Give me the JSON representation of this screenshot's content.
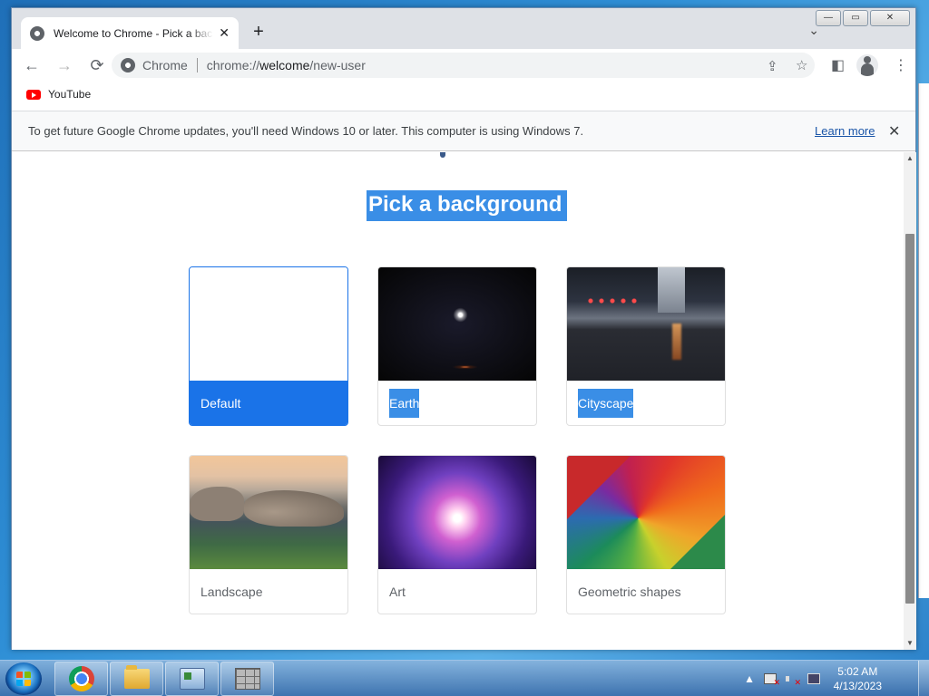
{
  "window": {
    "tab_title": "Welcome to Chrome - Pick a background",
    "controls": {
      "minimize": "—",
      "maximize": "▭",
      "close": "✕"
    },
    "new_tab": "+",
    "tab_search": "⌄"
  },
  "toolbar": {
    "site_chip": "Chrome",
    "url_prefix": "chrome://",
    "url_host": "welcome",
    "url_path": "/new-user",
    "back": "←",
    "forward": "→",
    "reload": "⟳"
  },
  "bookmarks": {
    "items": [
      {
        "label": "YouTube",
        "icon": "youtube-icon"
      }
    ]
  },
  "infobar": {
    "message": "To get future Google Chrome updates, you'll need Windows 10 or later. This computer is using Windows 7.",
    "learn_more": "Learn more",
    "close": "✕"
  },
  "page": {
    "headline": "Pick a background",
    "cards": [
      {
        "label": "Default",
        "selected": true
      },
      {
        "label": "Earth",
        "selected": false,
        "highlighted": true
      },
      {
        "label": "Cityscape",
        "selected": false,
        "highlighted": true
      },
      {
        "label": "Landscape",
        "selected": false
      },
      {
        "label": "Art",
        "selected": false
      },
      {
        "label": "Geometric shapes",
        "selected": false
      }
    ]
  },
  "taskbar": {
    "apps": [
      "chrome-icon",
      "folder-icon",
      "control-panel-icon",
      "firewall-icon"
    ],
    "clock_time": "5:02 AM",
    "clock_date": "4/13/2023",
    "tray_expand": "▲"
  },
  "colors": {
    "accent": "#1a73e8",
    "selection": "#3a8ee6",
    "link": "#1a55a8"
  }
}
